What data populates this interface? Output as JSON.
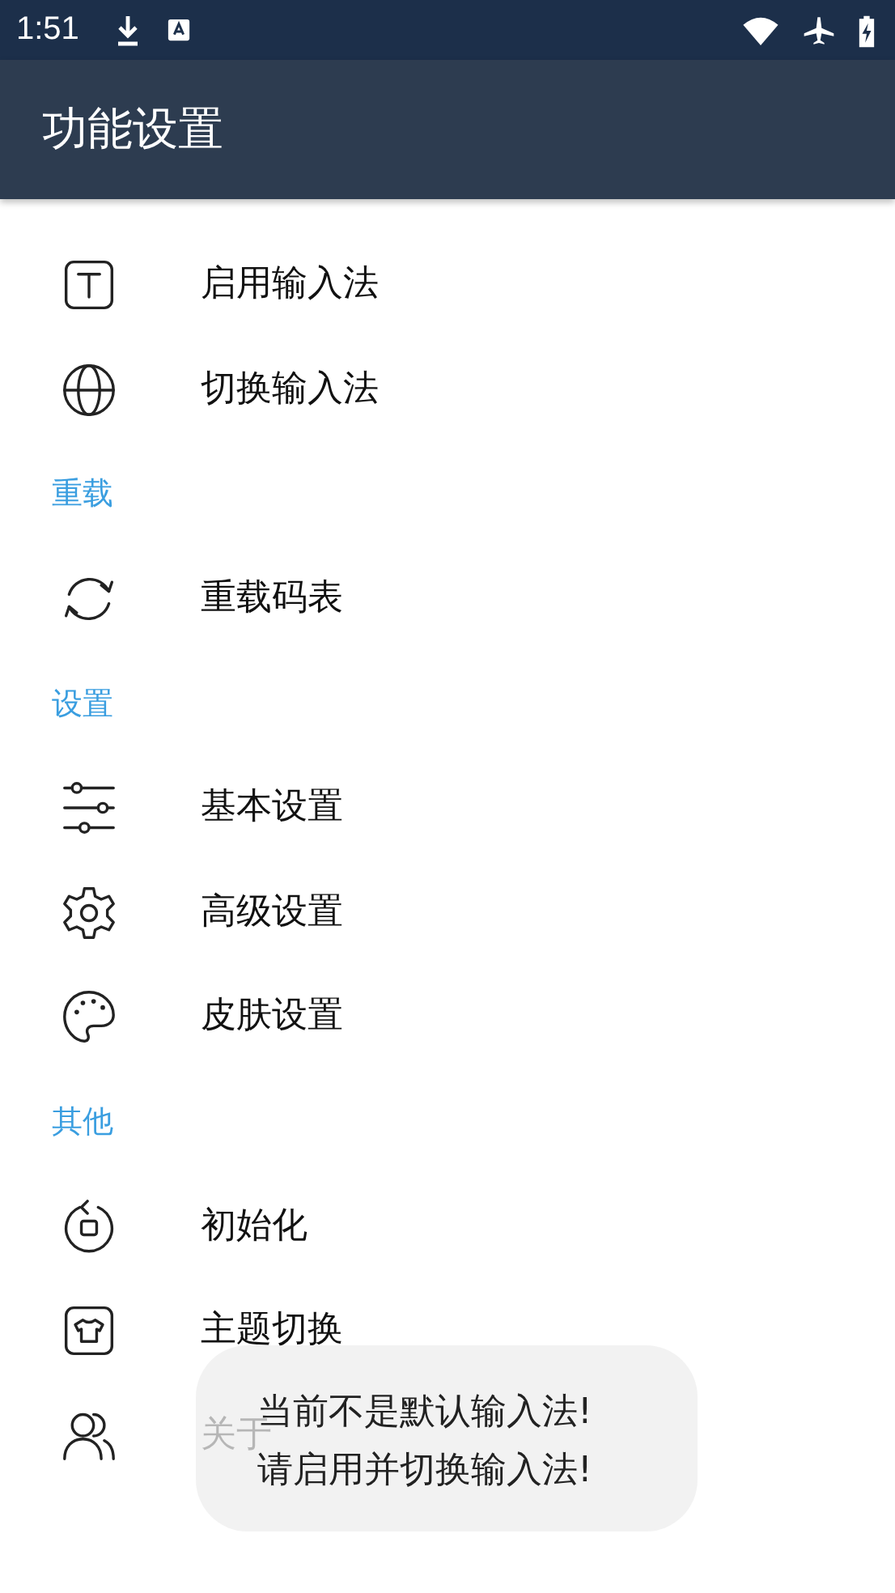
{
  "status_bar": {
    "time": "1:51"
  },
  "app_bar": {
    "title": "功能设置"
  },
  "list": [
    {
      "kind": "item",
      "label": "启用输入法"
    },
    {
      "kind": "item",
      "label": "切换输入法"
    },
    {
      "kind": "header",
      "label": "重载"
    },
    {
      "kind": "item",
      "label": "重载码表"
    },
    {
      "kind": "header",
      "label": "设置"
    },
    {
      "kind": "item",
      "label": "基本设置"
    },
    {
      "kind": "item",
      "label": "高级设置"
    },
    {
      "kind": "item",
      "label": "皮肤设置"
    },
    {
      "kind": "header",
      "label": "其他"
    },
    {
      "kind": "item",
      "label": "初始化"
    },
    {
      "kind": "item",
      "label": "主题切换"
    },
    {
      "kind": "item",
      "label": "关于"
    }
  ],
  "toast": {
    "lines": [
      "当前不是默认输入法!",
      "请启用并切换输入法!"
    ]
  }
}
